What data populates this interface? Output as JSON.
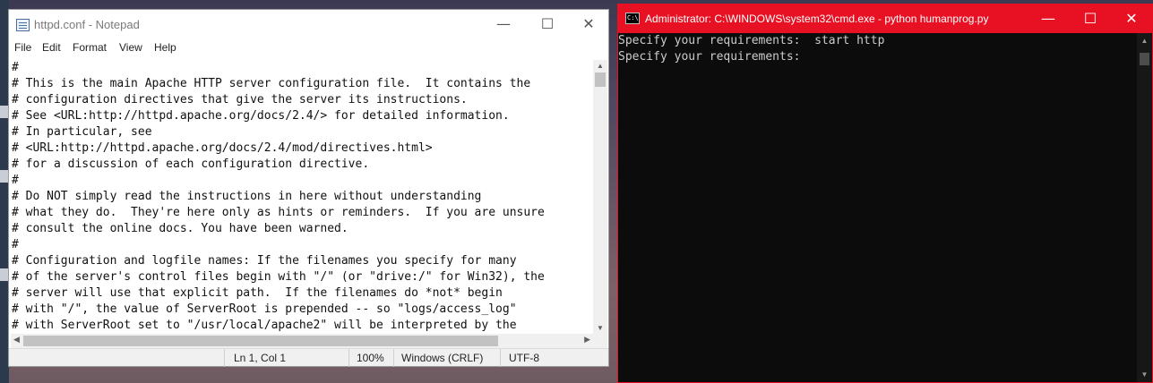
{
  "notepad": {
    "title": "httpd.conf - Notepad",
    "menu": [
      "File",
      "Edit",
      "Format",
      "View",
      "Help"
    ],
    "lines": [
      "#",
      "# This is the main Apache HTTP server configuration file.  It contains the",
      "# configuration directives that give the server its instructions.",
      "# See <URL:http://httpd.apache.org/docs/2.4/> for detailed information.",
      "# In particular, see",
      "# <URL:http://httpd.apache.org/docs/2.4/mod/directives.html>",
      "# for a discussion of each configuration directive.",
      "#",
      "# Do NOT simply read the instructions in here without understanding",
      "# what they do.  They're here only as hints or reminders.  If you are unsure",
      "# consult the online docs. You have been warned.",
      "#",
      "# Configuration and logfile names: If the filenames you specify for many",
      "# of the server's control files begin with \"/\" (or \"drive:/\" for Win32), the",
      "# server will use that explicit path.  If the filenames do *not* begin",
      "# with \"/\", the value of ServerRoot is prepended -- so \"logs/access_log\"",
      "# with ServerRoot set to \"/usr/local/apache2\" will be interpreted by the"
    ],
    "status": {
      "position": "Ln 1, Col 1",
      "zoom": "100%",
      "line_endings": "Windows (CRLF)",
      "encoding": "UTF-8"
    }
  },
  "console": {
    "title": "Administrator: C:\\WINDOWS\\system32\\cmd.exe - python  humanprog.py",
    "icon_text": "C:\\",
    "lines": [
      "Specify your requirements:  start http",
      "Specify your requirements:"
    ],
    "accent_color": "#e81123"
  },
  "captions": {
    "minimize": "—",
    "maximize": "☐",
    "close": "✕"
  }
}
